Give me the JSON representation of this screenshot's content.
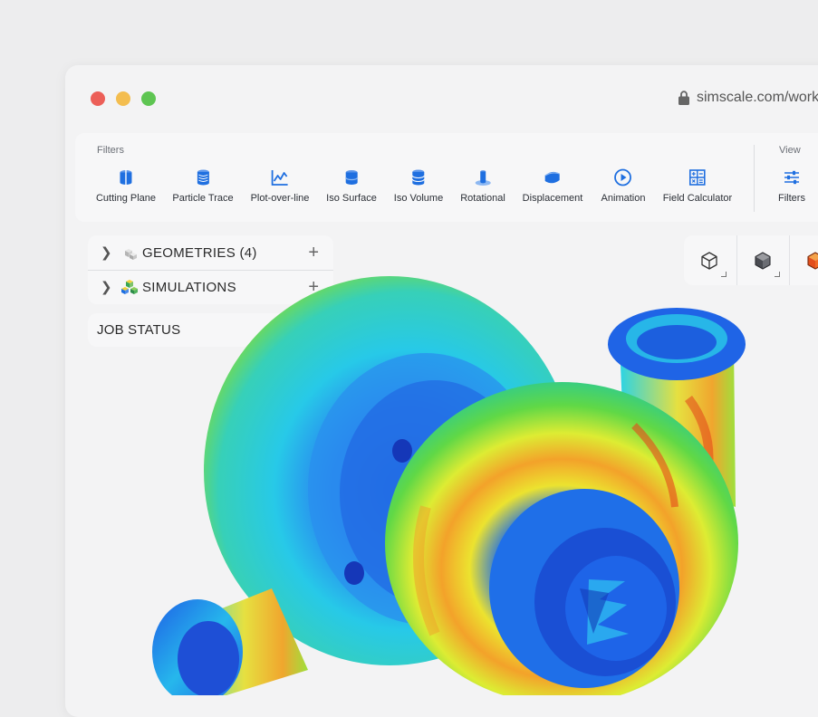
{
  "browser": {
    "url": "simscale.com/work"
  },
  "toolbar": {
    "filters_section_label": "Filters",
    "view_section_label": "View",
    "tools": [
      {
        "label": "Cutting Plane",
        "icon": "cutting-plane-icon"
      },
      {
        "label": "Particle Trace",
        "icon": "particle-trace-icon"
      },
      {
        "label": "Plot-over-line",
        "icon": "plot-over-line-icon"
      },
      {
        "label": "Iso Surface",
        "icon": "iso-surface-icon"
      },
      {
        "label": "Iso Volume",
        "icon": "iso-volume-icon"
      },
      {
        "label": "Rotational",
        "icon": "rotational-icon"
      },
      {
        "label": "Displacement",
        "icon": "displacement-icon"
      },
      {
        "label": "Animation",
        "icon": "play-icon"
      },
      {
        "label": "Field Calculator",
        "icon": "calculator-icon"
      }
    ],
    "view_tools": [
      {
        "label": "Filters",
        "icon": "sliders-icon"
      }
    ]
  },
  "tree": {
    "items": [
      {
        "label": "GEOMETRIES (4)",
        "icon": "geometries-icon"
      },
      {
        "label": "SIMULATIONS",
        "icon": "simulations-icon"
      }
    ]
  },
  "job_status": {
    "label": "JOB STATUS"
  },
  "viewcube": {
    "buttons": [
      "wireframe-cube-icon",
      "solid-cube-icon",
      "colored-cube-icon"
    ]
  },
  "colors": {
    "accent": "#1f6fe0",
    "close": "#ec5f58",
    "minimize": "#f3bd4f",
    "maximize": "#5ec552"
  }
}
